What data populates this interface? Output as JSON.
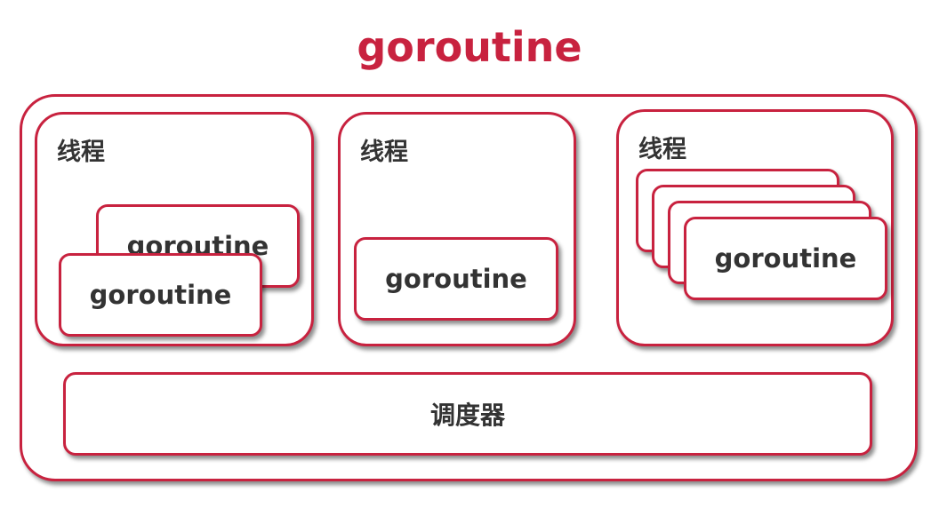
{
  "title": "goroutine",
  "threads": [
    {
      "label": "线程",
      "goroutines": [
        "goroutine",
        "goroutine"
      ]
    },
    {
      "label": "线程",
      "goroutines": [
        "goroutine"
      ]
    },
    {
      "label": "线程",
      "goroutines": [
        "goroutine"
      ]
    }
  ],
  "scheduler": {
    "label": "调度器"
  },
  "colors": {
    "accent": "#c8223f",
    "text": "#333333"
  }
}
